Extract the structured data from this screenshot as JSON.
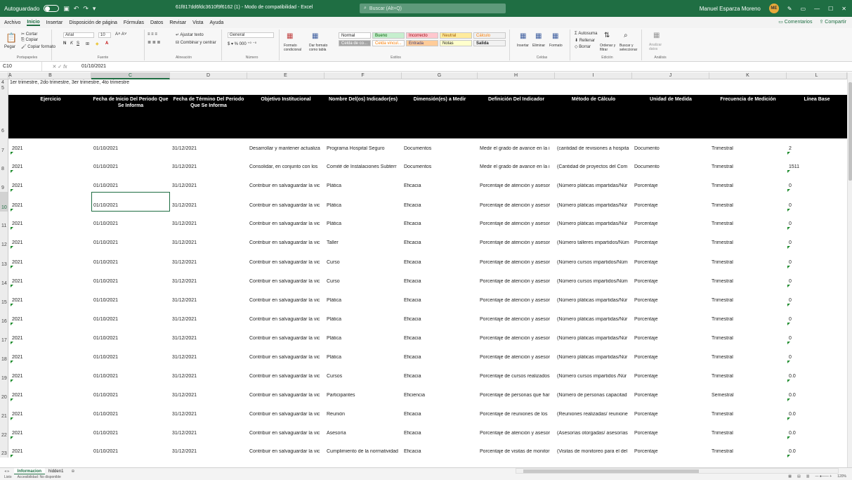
{
  "titlebar": {
    "autosave": "Autoguardado",
    "doc_title": "61f817dd6fdc3610f9f6162 (1) - Modo de compatibilidad - Excel",
    "search": "Buscar (Alt+Q)",
    "user": "Manuel Esparza Moreno",
    "user_initials": "ME"
  },
  "menu": [
    "Archivo",
    "Inicio",
    "Insertar",
    "Disposición de página",
    "Fórmulas",
    "Datos",
    "Revisar",
    "Vista",
    "Ayuda"
  ],
  "menu_right": {
    "comments": "Comentarios",
    "share": "Compartir"
  },
  "ribbon": {
    "clipboard": {
      "label": "Portapapeles",
      "paste": "Pegar",
      "cut": "Cortar",
      "copy": "Copiar",
      "format": "Copiar formato"
    },
    "font": {
      "label": "Fuente",
      "name": "Arial",
      "size": "10"
    },
    "alignment": {
      "label": "Alineación",
      "wrap": "Ajustar texto",
      "merge": "Combinar y centrar"
    },
    "number": {
      "label": "Número",
      "format": "General"
    },
    "styles": {
      "label": "Estilos",
      "cond": "Formato condicional",
      "table": "Dar formato como tabla",
      "items": [
        "Normal",
        "Bueno",
        "Incorrecto",
        "Neutral",
        "Cálculo",
        "Celda de co...",
        "Celda vincul...",
        "Entrada",
        "Notas",
        "Salida"
      ]
    },
    "cells": {
      "label": "Celdas",
      "insert": "Insertar",
      "delete": "Eliminar",
      "format": "Formato"
    },
    "editing": {
      "label": "Edición",
      "autosum": "Autosuma",
      "fill": "Rellenar",
      "clear": "Borrar",
      "sort": "Ordenar y filtrar",
      "find": "Buscar y seleccionar"
    },
    "analysis": {
      "label": "Análisis",
      "analyze": "Analizar datos"
    }
  },
  "formula": {
    "name_box": "C10",
    "fx": "fx",
    "value": "01/10/2021"
  },
  "columns": [
    "A",
    "B",
    "C",
    "D",
    "E",
    "F",
    "G",
    "H",
    "I",
    "J",
    "K",
    "L"
  ],
  "row4_text": "1er trimestre, 2do trimestre, 3er trimestre, 4to trimestre",
  "headers": [
    "Ejercicio",
    "Fecha de Inicio Del Periodo Que Se Informa",
    "Fecha de Término Del Periodo Que Se Informa",
    "Objetivo Institucional",
    "Nombre Del(os) Indicador(es)",
    "Dimensión(es) a Medir",
    "Definición Del Indicador",
    "Método de Cálculo",
    "Unidad de Medida",
    "Frecuencia de Medición",
    "Línea Base"
  ],
  "row_numbers": [
    "4",
    "5",
    "6",
    "7",
    "8",
    "9",
    "10",
    "11",
    "12",
    "13",
    "14",
    "15",
    "16",
    "17",
    "18",
    "19",
    "20",
    "21",
    "22",
    "23"
  ],
  "rows": [
    [
      "2021",
      "01/10/2021",
      "31/12/2021",
      "Desarrollar y mantener actualiza",
      "Programa Hospital Seguro",
      "Documentos",
      "Medir el grado de avance en la i",
      "(cantidad de revisiones a hospita",
      "Documento",
      "Trimestral",
      "2"
    ],
    [
      "2021",
      "01/10/2021",
      "31/12/2021",
      "Consolidar, en conjunto con los",
      "Comité de Instalaciones Subterr",
      "Documentos",
      "Medir el grado de avance en la i",
      "(Cantidad de proyectos del Com",
      "Documento",
      "Trimestral",
      "1511"
    ],
    [
      "2021",
      "01/10/2021",
      "31/12/2021",
      "Contribuir en salvaguardar la vic",
      "Plática",
      "Eficacia",
      "Porcentaje de atención y asesor",
      "(Número pláticas impartidas/Núr",
      "Porcentaje",
      "Trimestral",
      "0"
    ],
    [
      "2021",
      "01/10/2021",
      "31/12/2021",
      "Contribuir en salvaguardar la vic",
      "Plática",
      "Eficacia",
      "Porcentaje de atención y asesor",
      "(Número pláticas impartidas/Núr",
      "Porcentaje",
      "Trimestral",
      "0"
    ],
    [
      "2021",
      "01/10/2021",
      "31/12/2021",
      "Contribuir en salvaguardar la vic",
      "Plática",
      "Eficacia",
      "Porcentaje de atención y asesor",
      "(Número pláticas impartidas/Núr",
      "Porcentaje",
      "Trimestral",
      "0"
    ],
    [
      "2021",
      "01/10/2021",
      "31/12/2021",
      "Contribuir en salvaguardar la vic",
      "Taller",
      "Eficacia",
      "Porcentaje de atención y asesor",
      "(Número talleres impartidos/Núm",
      "Porcentaje",
      "Trimestral",
      "0"
    ],
    [
      "2021",
      "01/10/2021",
      "31/12/2021",
      "Contribuir en salvaguardar la vic",
      "Curso",
      "Eficacia",
      "Porcentaje de atención y asesor",
      "(Número cursos impartidos/Núm",
      "Porcentaje",
      "Trimestral",
      "0"
    ],
    [
      "2021",
      "01/10/2021",
      "31/12/2021",
      "Contribuir en salvaguardar la vic",
      "Curso",
      "Eficacia",
      "Porcentaje de atención y asesor",
      "(Número cursos impartidos/Núm",
      "Porcentaje",
      "Trimestral",
      "0"
    ],
    [
      "2021",
      "01/10/2021",
      "31/12/2021",
      "Contribuir en salvaguardar la vic",
      "Plática",
      "Eficacia",
      "Porcentaje de atención y asesor",
      "(Número pláticas impartidas/Núr",
      "Porcentaje",
      "Trimestral",
      "0"
    ],
    [
      "2021",
      "01/10/2021",
      "31/12/2021",
      "Contribuir en salvaguardar la vic",
      "Plática",
      "Eficacia",
      "Porcentaje de atención y asesor",
      "(Número pláticas impartidas/Núr",
      "Porcentaje",
      "Trimestral",
      "0"
    ],
    [
      "2021",
      "01/10/2021",
      "31/12/2021",
      "Contribuir en salvaguardar la vic",
      "Plática",
      "Eficacia",
      "Porcentaje de atención y asesor",
      "(Número pláticas impartidas/Núr",
      "Porcentaje",
      "Trimestral",
      "0"
    ],
    [
      "2021",
      "01/10/2021",
      "31/12/2021",
      "Contribuir en salvaguardar la vic",
      "Plática",
      "Eficacia",
      "Porcentaje de atención y asesor",
      "(Número pláticas impartidas/Núr",
      "Porcentaje",
      "Trimestral",
      "0"
    ],
    [
      "2021",
      "01/10/2021",
      "31/12/2021",
      "Contribuir en salvaguardar la vic",
      "Cursos",
      "Eficacia",
      "Porcentaje de cursos realizados",
      "(Número cursos impartidos /Núr",
      "Porcentaje",
      "Trimestral",
      "0.0"
    ],
    [
      "2021",
      "01/10/2021",
      "31/12/2021",
      "Contribuir en salvaguardar la vic",
      "Participantes",
      "Eficiencia",
      "Porcentaje de personas que har",
      "(Número de personas capacitad",
      "Porcentaje",
      "Semestral",
      "0.0"
    ],
    [
      "2021",
      "01/10/2021",
      "31/12/2021",
      "Contribuir en salvaguardar la vic",
      "Reunión",
      "Eficacia",
      "Porcentaje de reuniones de los",
      "(Reuniones realizadas/ reunione",
      "Porcentaje",
      "Trimestral",
      "0.0"
    ],
    [
      "2021",
      "01/10/2021",
      "31/12/2021",
      "Contribuir en salvaguardar la vic",
      "Asesoría",
      "Eficacia",
      "Porcentaje de atención y asesor",
      "(Asesorías otorgadas/ asesorías",
      "Porcentaje",
      "Trimestral",
      "0.0"
    ],
    [
      "2021",
      "01/10/2021",
      "31/12/2021",
      "Contribuir en salvaguardar la vic",
      "Cumplimiento de la normatividad",
      "Eficacia",
      "Porcentaje de visitas de monitor",
      "(Visitas de monitoreo para el del",
      "Porcentaje",
      "Trimestral",
      "0.0"
    ]
  ],
  "sheets": [
    "Informacion",
    "hidden1"
  ],
  "status": {
    "accessibility": "Accesibilidad: No disponible",
    "mode": "Listo",
    "zoom": "120%"
  }
}
